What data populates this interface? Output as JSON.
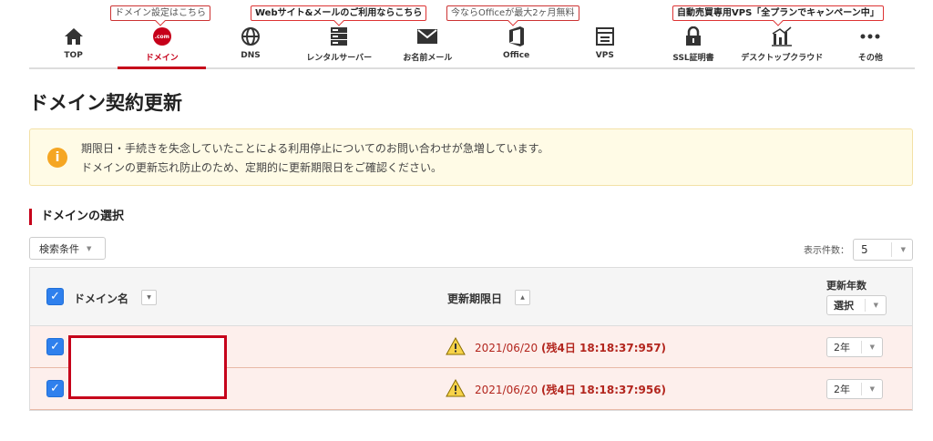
{
  "nav": {
    "promos": [
      {
        "text": "ドメイン設定はこちら"
      },
      {
        "text": "Webサイト&メールのご利用ならこちら"
      },
      {
        "text": "今ならOfficeが最大2ヶ月無料"
      },
      {
        "text": "自動売買専用VPS「全プランでキャンペーン中」"
      }
    ],
    "items": [
      {
        "label": "TOP",
        "icon": "home-icon"
      },
      {
        "label": "ドメイン",
        "icon": "dotcom-icon",
        "icon_text": ".com",
        "active": true
      },
      {
        "label": "DNS",
        "icon": "globe-icon"
      },
      {
        "label": "レンタルサーバー",
        "icon": "server-icon"
      },
      {
        "label": "お名前メール",
        "icon": "mail-icon"
      },
      {
        "label": "Office",
        "icon": "office-icon"
      },
      {
        "label": "VPS",
        "icon": "vps-icon"
      },
      {
        "label": "SSL証明書",
        "icon": "lock-icon"
      },
      {
        "label": "デスクトップクラウド",
        "icon": "chart-icon"
      },
      {
        "label": "その他",
        "icon": "more-icon"
      }
    ]
  },
  "page": {
    "title": "ドメイン契約更新"
  },
  "notice": {
    "icon_text": "i",
    "line1": "期限日・手続きを失念していたことによる利用停止についてのお問い合わせが急増しています。",
    "line2": "ドメインの更新忘れ防止のため、定期的に更新期限日をご確認ください。"
  },
  "section": {
    "title": "ドメインの選択",
    "search_conditions": "検索条件",
    "per_page_label": "表示件数：",
    "per_page_value": "5"
  },
  "table": {
    "headers": {
      "domain": "ドメイン名",
      "expiry": "更新期限日",
      "years": "更新年数",
      "years_select": "選択"
    },
    "rows": [
      {
        "checked": true,
        "expiry": "2021/06/20",
        "remaining": "(残4日 18:18:37:957)",
        "years": "2年"
      },
      {
        "checked": true,
        "expiry": "2021/06/20",
        "remaining": "(残4日 18:18:37:956)",
        "years": "2年"
      }
    ]
  },
  "colors": {
    "brand": "#c6001a",
    "checkbox": "#2f80ed",
    "notice_bg": "#fffbe6",
    "row_bg": "#fdefec"
  }
}
